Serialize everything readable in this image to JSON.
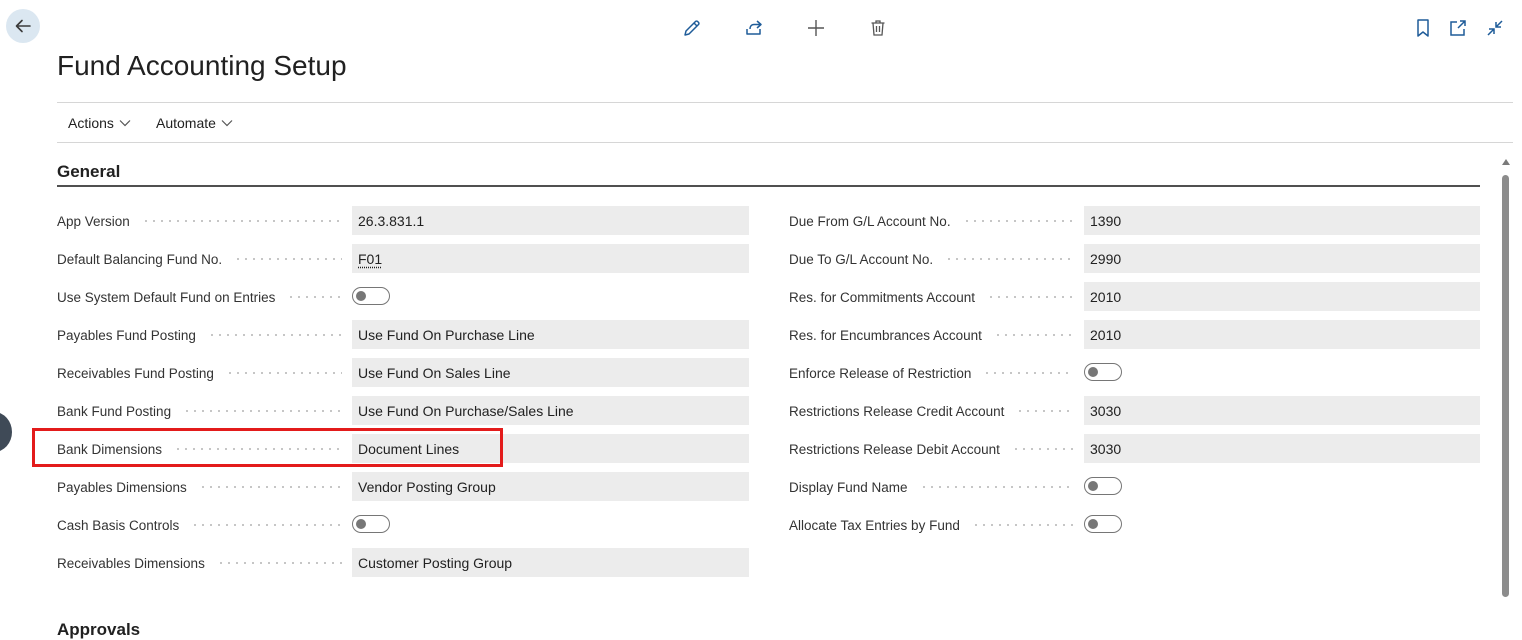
{
  "page": {
    "title": "Fund Accounting Setup"
  },
  "toolbar": {
    "icons": [
      "edit-icon",
      "share-icon",
      "add-icon",
      "delete-icon",
      "bookmark-icon",
      "open-new-window-icon",
      "collapse-icon"
    ]
  },
  "action_bar": {
    "actions": "Actions",
    "automate": "Automate"
  },
  "general": {
    "title": "General",
    "left": {
      "app_version": {
        "label": "App Version",
        "value": "26.3.831.1"
      },
      "default_balancing_fund": {
        "label": "Default Balancing Fund No.",
        "value": "F01"
      },
      "use_system_default_fund": {
        "label": "Use System Default Fund on Entries",
        "value": false
      },
      "payables_fund_posting": {
        "label": "Payables Fund Posting",
        "value": "Use Fund On Purchase Line"
      },
      "receivables_fund_posting": {
        "label": "Receivables Fund Posting",
        "value": "Use Fund On Sales Line"
      },
      "bank_fund_posting": {
        "label": "Bank Fund Posting",
        "value": "Use Fund On Purchase/Sales Line"
      },
      "bank_dimensions": {
        "label": "Bank Dimensions",
        "value": "Document Lines"
      },
      "payables_dimensions": {
        "label": "Payables Dimensions",
        "value": "Vendor Posting Group"
      },
      "cash_basis_controls": {
        "label": "Cash Basis Controls",
        "value": false
      },
      "receivables_dimensions": {
        "label": "Receivables Dimensions",
        "value": "Customer Posting Group"
      }
    },
    "right": {
      "due_from_gl": {
        "label": "Due From G/L Account No.",
        "value": "1390"
      },
      "due_to_gl": {
        "label": "Due To G/L Account No.",
        "value": "2990"
      },
      "res_commitments": {
        "label": "Res. for Commitments Account",
        "value": "2010"
      },
      "res_encumbrances": {
        "label": "Res. for Encumbrances Account",
        "value": "2010"
      },
      "enforce_release": {
        "label": "Enforce Release of Restriction",
        "value": false
      },
      "release_credit": {
        "label": "Restrictions Release Credit Account",
        "value": "3030"
      },
      "release_debit": {
        "label": "Restrictions Release Debit Account",
        "value": "3030"
      },
      "display_fund_name": {
        "label": "Display Fund Name",
        "value": false
      },
      "allocate_tax": {
        "label": "Allocate Tax Entries by Fund",
        "value": false
      }
    }
  },
  "next_section": {
    "title": "Approvals"
  },
  "colors": {
    "highlight": "#e31b1b",
    "back_button_bg": "#dbe7f1",
    "toolbar_icon": "#1f5c99",
    "field_bg": "#ececec"
  }
}
